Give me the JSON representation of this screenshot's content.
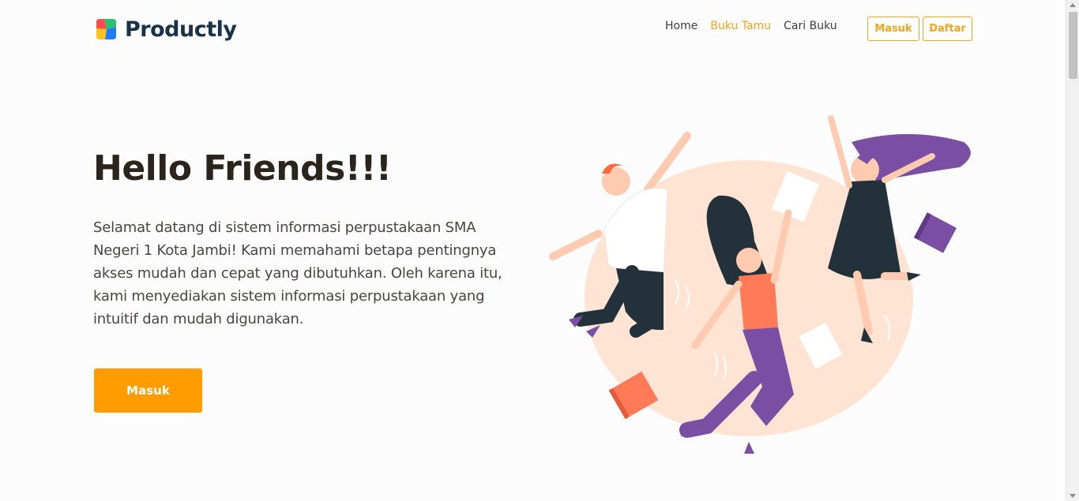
{
  "brand": {
    "name": "Productly",
    "logo_icon": "productly-logo-icon"
  },
  "nav": {
    "links": [
      {
        "label": "Home",
        "active": false
      },
      {
        "label": "Buku Tamu",
        "active": true
      },
      {
        "label": "Cari Buku",
        "active": false
      }
    ],
    "login_label": "Masuk",
    "register_label": "Daftar"
  },
  "hero": {
    "title": "Hello Friends!!!",
    "description": "Selamat datang di sistem informasi perpustakaan SMA Negeri 1 Kota Jambi! Kami memahami betapa pentingnya akses mudah dan cepat yang dibutuhkan. Oleh karena itu, kami menyediakan sistem informasi perpustakaan yang intuitif dan mudah digunakan.",
    "cta_label": "Masuk",
    "illustration_icon": "jumping-friends-illustration"
  },
  "colors": {
    "accent": "#f5a41b",
    "cta": "#ff9c00",
    "brand_text": "#18324a",
    "title_text": "#2b241d",
    "illustration_bg": "#ffe3d3"
  }
}
